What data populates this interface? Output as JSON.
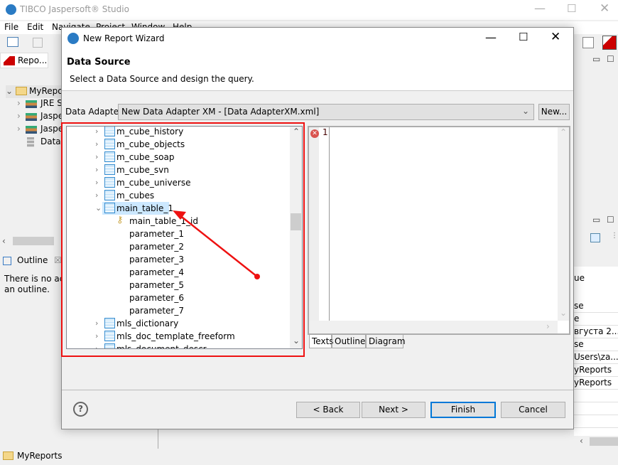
{
  "app": {
    "title": "TIBCO Jaspersoft® Studio",
    "menu": [
      "File",
      "Edit",
      "Navigate",
      "Project",
      "Window",
      "Help"
    ],
    "repo_tab": "Repo...",
    "tree": [
      "MyRepo",
      "JRE Sy",
      "Jasper",
      "Jasper",
      "Data"
    ],
    "outline_tab": "Outline",
    "outline_text_1": "There is no acti",
    "outline_text_2": "an outline.",
    "status_project": "MyReports",
    "properties": [
      "ue",
      "se",
      "e",
      "вгуста 2...",
      "se",
      "Users\\za...",
      "yReports",
      "yReports"
    ]
  },
  "dialog": {
    "title": "New Report Wizard",
    "heading": "Data Source",
    "subtitle": "Select a Data Source and design the query.",
    "adapter_label": "Data Adapter",
    "adapter_value": "New Data Adapter XM - [Data AdapterXM.xml]",
    "new_button": "New...",
    "tree_items": [
      {
        "label": "m_cube_history",
        "level": 0,
        "expanded": false,
        "icon": "table-icon"
      },
      {
        "label": "m_cube_objects",
        "level": 0,
        "expanded": false,
        "icon": "table-icon"
      },
      {
        "label": "m_cube_soap",
        "level": 0,
        "expanded": false,
        "icon": "table-icon"
      },
      {
        "label": "m_cube_svn",
        "level": 0,
        "expanded": false,
        "icon": "table-icon"
      },
      {
        "label": "m_cube_universe",
        "level": 0,
        "expanded": false,
        "icon": "table-icon"
      },
      {
        "label": "m_cubes",
        "level": 0,
        "expanded": false,
        "icon": "table-icon"
      },
      {
        "label": "main_table_1",
        "level": 0,
        "expanded": true,
        "selected": true,
        "icon": "table-icon"
      },
      {
        "label": "main_table_1_id",
        "level": 1,
        "icon": "key-icon"
      },
      {
        "label": "parameter_1",
        "level": 1
      },
      {
        "label": "parameter_2",
        "level": 1
      },
      {
        "label": "parameter_3",
        "level": 1
      },
      {
        "label": "parameter_4",
        "level": 1
      },
      {
        "label": "parameter_5",
        "level": 1
      },
      {
        "label": "parameter_6",
        "level": 1
      },
      {
        "label": "parameter_7",
        "level": 1
      },
      {
        "label": "mls_dictionary",
        "level": 0,
        "expanded": false,
        "icon": "table-icon"
      },
      {
        "label": "mls_doc_template_freeform",
        "level": 0,
        "expanded": false,
        "icon": "table-icon"
      },
      {
        "label": "mls_document_descr",
        "level": 0,
        "expanded": false,
        "icon": "table-icon"
      }
    ],
    "line_number": "1",
    "query_tabs": [
      "Texts",
      "Outline",
      "Diagram"
    ],
    "back": "< Back",
    "next": "Next >",
    "finish": "Finish",
    "cancel": "Cancel",
    "help_icon": "?"
  },
  "colors": {
    "annotation": "#ee1111",
    "selection": "#cce8ff",
    "focus": "#0078d7"
  }
}
